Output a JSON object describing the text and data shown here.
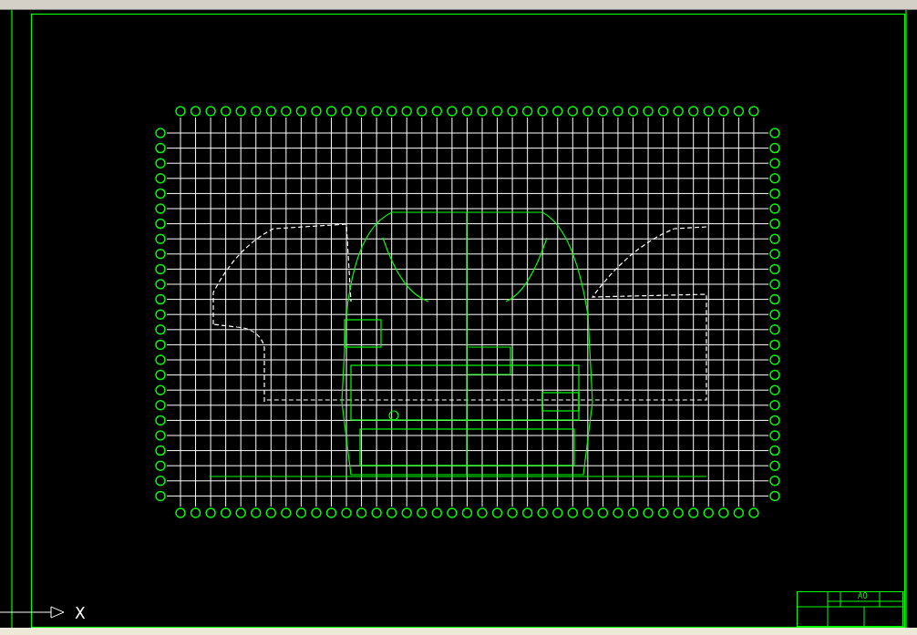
{
  "ucs_icon": {
    "axis_label": "X"
  },
  "title_block": {
    "sheet_size": "A0"
  }
}
